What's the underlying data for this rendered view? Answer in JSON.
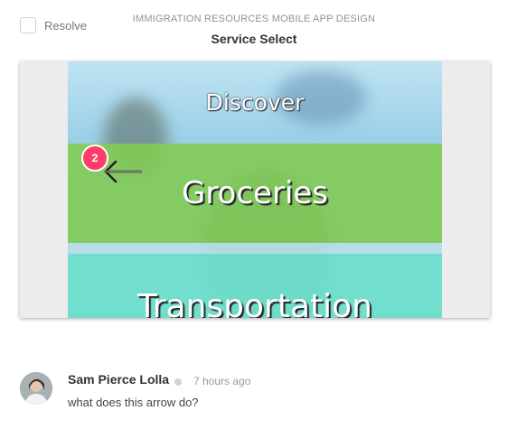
{
  "resolve": {
    "label": "Resolve",
    "checked": false
  },
  "header": {
    "project": "IMMIGRATION RESOURCES MOBILE APP DESIGN",
    "screen": "Service Select"
  },
  "preview": {
    "services": [
      "Discover",
      "Groceries",
      "Transportation"
    ],
    "pin_number": "2",
    "pin_color": "#ff3d6b",
    "groceries_color": "#84cc52",
    "transportation_color": "#70e1cd"
  },
  "comment": {
    "author": "Sam Pierce Lolla",
    "timestamp": "7 hours ago",
    "text": "what does this arrow do?"
  }
}
